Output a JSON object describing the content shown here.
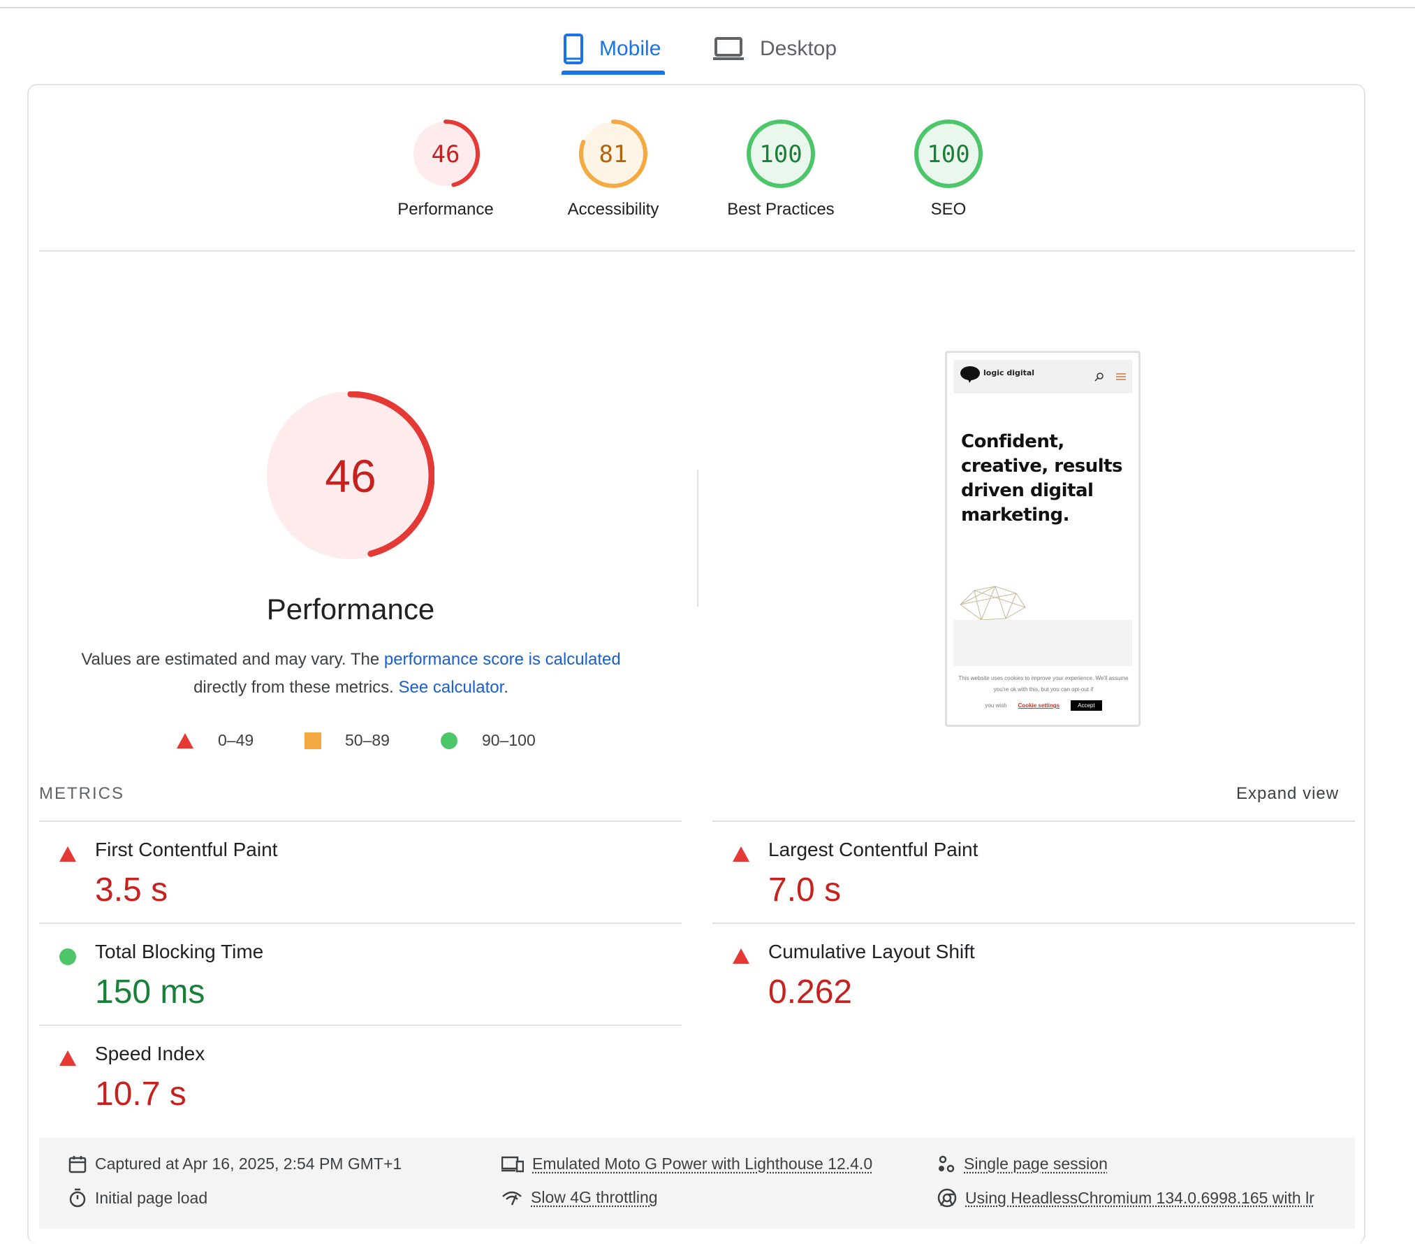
{
  "tabs": [
    {
      "label": "Mobile",
      "active": true
    },
    {
      "label": "Desktop",
      "active": false
    }
  ],
  "scores": [
    {
      "label": "Performance",
      "value": "46",
      "fraction": 0.46,
      "color": "#e53935",
      "bg": "#fdeceb",
      "text_color": "#c5221f"
    },
    {
      "label": "Accessibility",
      "value": "81",
      "fraction": 0.81,
      "color": "#f4a942",
      "bg": "#fef5e7",
      "text_color": "#b3650d"
    },
    {
      "label": "Best Practices",
      "value": "100",
      "fraction": 1.0,
      "color": "#4cc668",
      "bg": "#eaf7ec",
      "text_color": "#188038"
    },
    {
      "label": "SEO",
      "value": "100",
      "fraction": 1.0,
      "color": "#4cc668",
      "bg": "#eaf7ec",
      "text_color": "#188038"
    }
  ],
  "main_gauge": {
    "value": "46",
    "fraction": 0.46,
    "title": "Performance"
  },
  "description": {
    "text_before": "Values are estimated and may vary. The ",
    "link1": "performance score is calculated",
    "text_middle": " directly from these metrics. ",
    "link2": "See calculator",
    "text_after": "."
  },
  "legend": [
    {
      "shape": "triangle",
      "label": "0–49",
      "color": "#e53935"
    },
    {
      "shape": "square",
      "label": "50–89",
      "color": "#f4a942"
    },
    {
      "shape": "circle",
      "label": "90–100",
      "color": "#4cc668"
    }
  ],
  "screenshot": {
    "logo_text": "logic digital",
    "heading": "Confident, creative, results driven digital marketing.",
    "cookie_text": "This website uses cookies to improve your experience. We'll assume you're ok with this, but you can opt-out if",
    "cookie_wish": "you wish",
    "cookie_settings": "Cookie settings",
    "accept": "Accept"
  },
  "metrics": {
    "title": "METRICS",
    "expand_label": "Expand view",
    "items": [
      {
        "name": "First Contentful Paint",
        "value": "3.5 s",
        "rating": "poor"
      },
      {
        "name": "Largest Contentful Paint",
        "value": "7.0 s",
        "rating": "poor"
      },
      {
        "name": "Total Blocking Time",
        "value": "150 ms",
        "rating": "good"
      },
      {
        "name": "Cumulative Layout Shift",
        "value": "0.262",
        "rating": "poor"
      },
      {
        "name": "Speed Index",
        "value": "10.7 s",
        "rating": "poor"
      }
    ]
  },
  "footer": {
    "captured": "Captured at Apr 16, 2025, 2:54 PM GMT+1",
    "initial_load": "Initial page load",
    "emulated": "Emulated Moto G Power with Lighthouse 12.4.0",
    "throttling": "Slow 4G throttling",
    "session": "Single page session",
    "browser": "Using HeadlessChromium 134.0.6998.165 with lr"
  }
}
